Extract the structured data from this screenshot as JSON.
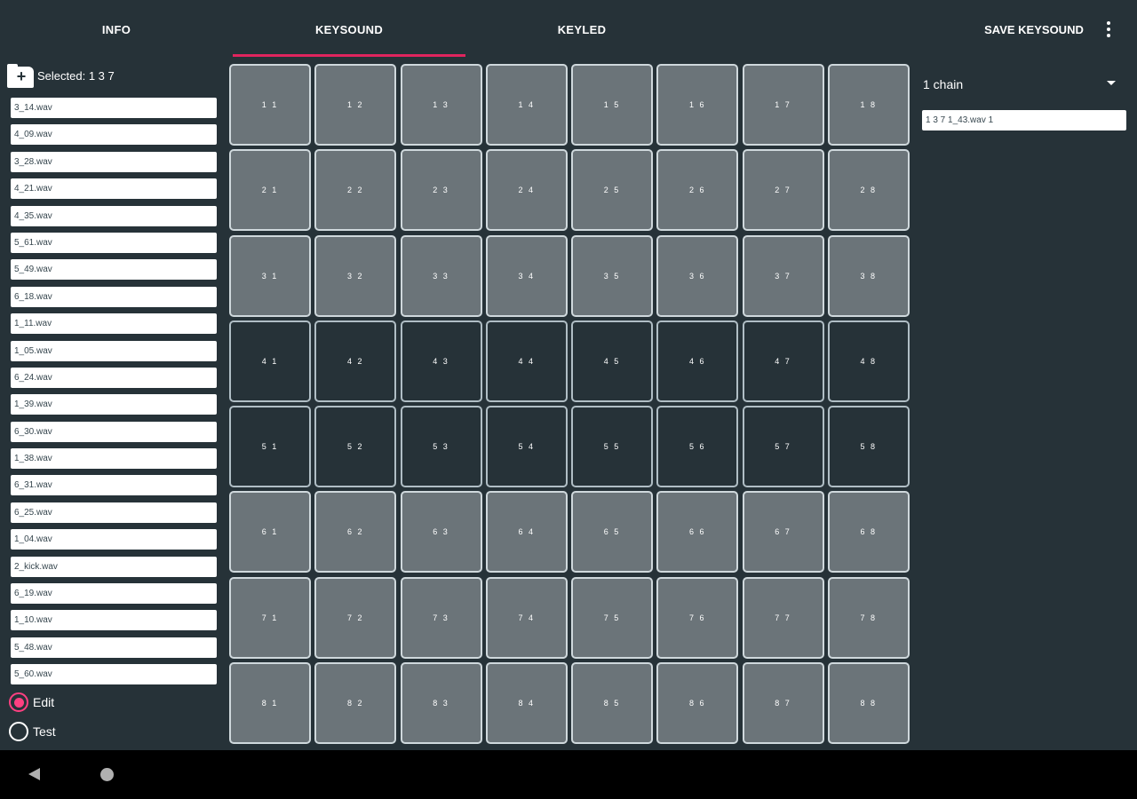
{
  "tabs": [
    {
      "label": "INFO",
      "active": false
    },
    {
      "label": "KEYSOUND",
      "active": true
    },
    {
      "label": "KEYLED",
      "active": false
    }
  ],
  "actions": {
    "save_label": "SAVE KEYSOUND",
    "overflow_icon": "more-vert-icon"
  },
  "colors": {
    "background": "#263238",
    "accent": "#e0245e",
    "pad_light": "#6b7479",
    "pad_dark": "#263238"
  },
  "left_panel": {
    "folder_icon": "create-new-folder-icon",
    "selected_text": "Selected: 1 3 7",
    "files": [
      "3_14.wav",
      "4_09.wav",
      "3_28.wav",
      "4_21.wav",
      "4_35.wav",
      "5_61.wav",
      "5_49.wav",
      "6_18.wav",
      "1_11.wav",
      "1_05.wav",
      "6_24.wav",
      "1_39.wav",
      "6_30.wav",
      "1_38.wav",
      "6_31.wav",
      "6_25.wav",
      "1_04.wav",
      "2_kick.wav",
      "6_19.wav",
      "1_10.wav",
      "5_48.wav",
      "5_60.wav"
    ],
    "mode": {
      "edit_label": "Edit",
      "test_label": "Test",
      "selected": "edit"
    }
  },
  "grid": {
    "rows": 8,
    "cols": 8,
    "dark_rows": [
      4,
      5
    ]
  },
  "right_panel": {
    "chain_select": "1 chain",
    "assigned": [
      "1 3 7 1_43.wav 1"
    ]
  },
  "system_nav": {
    "back_icon": "back-triangle-icon",
    "home_icon": "home-circle-icon"
  }
}
